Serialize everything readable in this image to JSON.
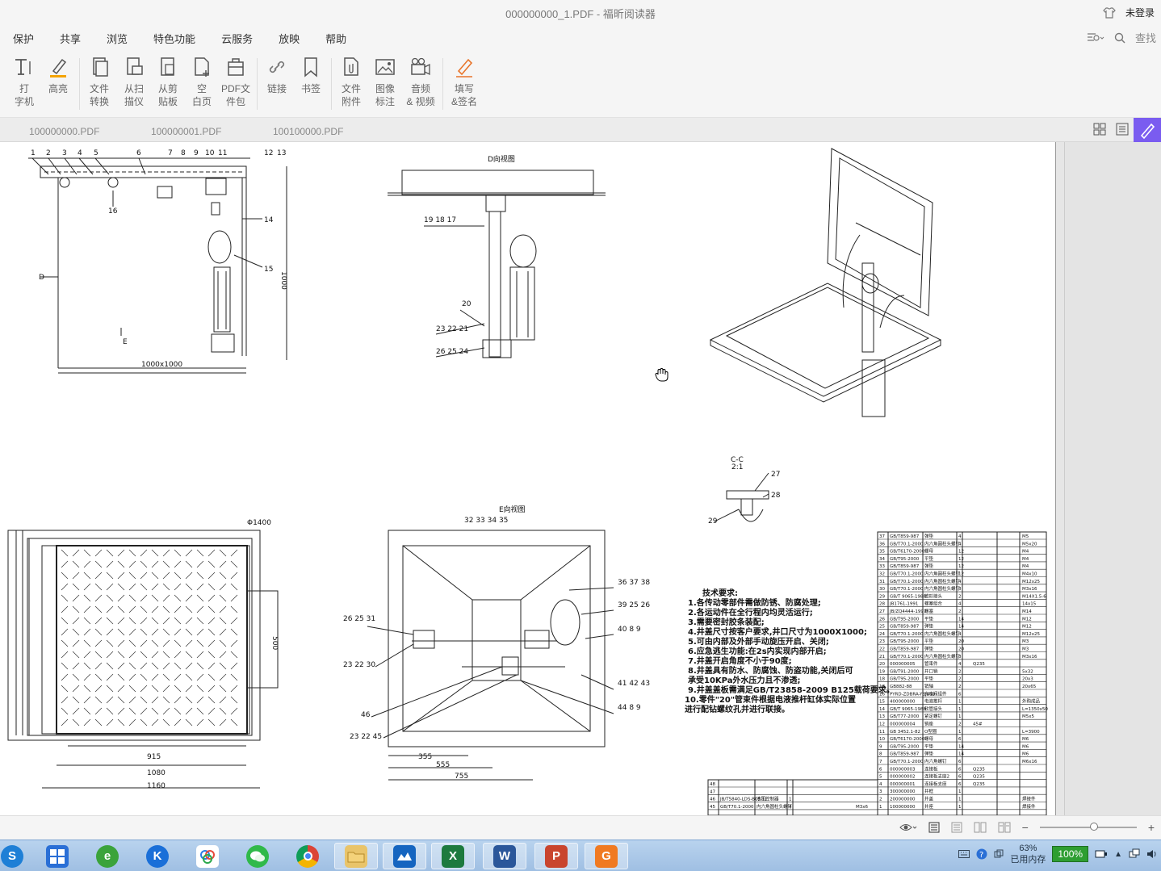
{
  "window": {
    "title": "000000000_1.PDF - 福昕阅读器",
    "login": "未登录"
  },
  "menu": [
    "保护",
    "共享",
    "浏览",
    "特色功能",
    "云服务",
    "放映",
    "帮助"
  ],
  "search": {
    "label": "查找"
  },
  "ribbon": [
    {
      "label1": "打",
      "label2": "字机",
      "icon": "typewriter-icon"
    },
    {
      "label1": "高亮",
      "label2": "",
      "icon": "highlight-icon"
    },
    {
      "label1": "文件",
      "label2": "转换",
      "icon": "file-convert-icon"
    },
    {
      "label1": "从扫",
      "label2": "描仪",
      "icon": "scanner-icon"
    },
    {
      "label1": "从剪",
      "label2": "贴板",
      "icon": "clipboard-icon"
    },
    {
      "label1": "空",
      "label2": "白页",
      "icon": "blank-page-icon"
    },
    {
      "label1": "PDF文",
      "label2": "件包",
      "icon": "pdf-package-icon"
    },
    {
      "label1": "链接",
      "label2": "",
      "icon": "link-icon"
    },
    {
      "label1": "书签",
      "label2": "",
      "icon": "bookmark-icon"
    },
    {
      "label1": "文件",
      "label2": "附件",
      "icon": "attachment-icon"
    },
    {
      "label1": "图像",
      "label2": "标注",
      "icon": "image-annotation-icon"
    },
    {
      "label1": "音频",
      "label2": "& 视频",
      "icon": "audio-video-icon"
    },
    {
      "label1": "填写",
      "label2": "&签名",
      "icon": "fill-sign-icon"
    }
  ],
  "tabs": [
    "100000000.PDF",
    "100000001.PDF",
    "100100000.PDF"
  ],
  "drawing": {
    "view_d": "D向视图",
    "view_e": "E向视图",
    "section": "C-C",
    "scale": "2:1",
    "dim_1000x1000": "1000x1000",
    "dim_1000": "1000",
    "dim_915": "915",
    "dim_1080": "1080",
    "dim_1160": "1160",
    "dim_500": "500",
    "dim_355": "355",
    "dim_555": "555",
    "dim_755": "755",
    "dim_phi": "Φ1400",
    "label_d": "D",
    "label_e": "E",
    "top_callouts": [
      "1",
      "2",
      "3",
      "4",
      "5",
      "6",
      "7",
      "8",
      "9",
      "10",
      "11",
      "12",
      "13"
    ],
    "side_callouts": [
      "14",
      "15",
      "16"
    ],
    "mid_callouts_a": "19  18  17",
    "mid_callouts_b": "20",
    "mid_callouts_c": "23  22  21",
    "mid_callouts_d": "26  25  24",
    "e_callouts": [
      "32  33  34  35",
      "36  37  38",
      "39  25  26",
      "40  8  9",
      "41  42  43",
      "44  8  9",
      "26  25  31",
      "23  22  30",
      "46",
      "23  22  45"
    ],
    "c_callouts": [
      "27",
      "28",
      "29"
    ],
    "notes_title": "技术要求:",
    "notes": [
      "1.各传动零部件需做防锈、防腐处理;",
      "2.各运动件在全行程内均灵活运行;",
      "3.需要密封胶条装配;",
      "4.井盖尺寸按客户要求,井口尺寸为1000X1000;",
      "5.可由内部及外部手动旋压开启、关闭;",
      "6.应急逃生功能:在2s内实现内部开启;",
      "7.井盖开启角度不小于90度;",
      "8.井盖具有防水、防腐蚀、防盗功能,关闭后可",
      "  承受10KPa外水压力且不渗透;",
      "9.井盖盖板需满足GB/T23858-2009 B125载荷要求。",
      "10.零件\"20\"管束件根据电液推杆缸体实际位置",
      "   进行配钻螺纹孔并进行联接。"
    ],
    "bom": [
      [
        "37",
        "GB/T859-987",
        "弹垫",
        "4",
        "",
        "M5"
      ],
      [
        "36",
        "GB/T70.1-2000",
        "内六角圆柱头螺钉",
        "4",
        "",
        "M5x20"
      ],
      [
        "35",
        "GB/T6170-2000",
        "螺母",
        "12",
        "",
        "M4"
      ],
      [
        "34",
        "GB/T95-2000",
        "平垫",
        "12",
        "",
        "M4"
      ],
      [
        "33",
        "GB/T859-987",
        "弹垫",
        "12",
        "",
        "M4"
      ],
      [
        "32",
        "GB/T70.1-2000",
        "内六角圆柱头螺钉",
        "12",
        "",
        "M4x10"
      ],
      [
        "31",
        "GB/T70.1-2000",
        "内六角圆柱头螺钉",
        "4",
        "",
        "M12x25"
      ],
      [
        "30",
        "GB/T70.1-2000",
        "内六角圆柱头螺钉",
        "8",
        "",
        "M3x16"
      ],
      [
        "29",
        "GB/T 9065-1988",
        "锥形接头",
        "2",
        "",
        "M14X1.5-6"
      ],
      [
        "28",
        "JB1761-1991",
        "螺塞组合",
        "4",
        "",
        "14x15"
      ],
      [
        "27",
        "JB/ZQ4444-1997",
        "螺塞",
        "2",
        "",
        "M14"
      ],
      [
        "26",
        "GB/T95-2000",
        "平垫",
        "14",
        "",
        "M12"
      ],
      [
        "25",
        "GB/T859-987",
        "弹垫",
        "14",
        "",
        "M12"
      ],
      [
        "24",
        "GB/T70.1-2000",
        "内六角圆柱头螺钉",
        "4",
        "",
        "M12x25"
      ],
      [
        "23",
        "GB/T95-2000",
        "平垫",
        "20",
        "",
        "M3"
      ],
      [
        "22",
        "GB/T859-987",
        "弹垫",
        "20",
        "",
        "M3"
      ],
      [
        "21",
        "GB/T70.1-2000",
        "内六角圆柱头螺钉",
        "8",
        "",
        "M3x16"
      ],
      [
        "20",
        "000000005",
        "管束件",
        "4",
        "Q235",
        ""
      ],
      [
        "19",
        "GB/T91-2000",
        "开口销",
        "2",
        "",
        "5x32"
      ],
      [
        "18",
        "GB/T95-2000",
        "平垫",
        "2",
        "",
        "20x3"
      ],
      [
        "17",
        "GB882-88",
        "销轴",
        "2",
        "",
        "20x65"
      ],
      [
        "16",
        "PYRD-ZDBRA-YBJ450",
        "充电阀组件",
        "6",
        "",
        ""
      ],
      [
        "15",
        "400000000",
        "电液推杆",
        "1",
        "",
        "外购成品"
      ],
      [
        "14",
        "GB/T 9065-1988",
        "软管接头",
        "1",
        "",
        "L=1350x50"
      ],
      [
        "13",
        "GB/T77-2000",
        "紧定螺钉",
        "1",
        "",
        "M5x5"
      ],
      [
        "12",
        "000000004",
        "销座",
        "2",
        "45#",
        ""
      ],
      [
        "11",
        "GB 3452.1-82",
        "O型圈",
        "1",
        "",
        "L=3900"
      ],
      [
        "10",
        "GB/T6170-2000",
        "螺母",
        "6",
        "",
        "M6"
      ],
      [
        "9",
        "GB/T95-2000",
        "平垫",
        "14",
        "",
        "M6"
      ],
      [
        "8",
        "GB/T859-987",
        "弹垫",
        "14",
        "",
        "M6"
      ],
      [
        "7",
        "GB/T70.1-2000",
        "内六角螺钉",
        "6",
        "",
        "M6x16"
      ],
      [
        "6",
        "000000003",
        "连接板",
        "6",
        "Q235",
        ""
      ],
      [
        "5",
        "000000002",
        "连接板支座2",
        "6",
        "Q235",
        ""
      ],
      [
        "4",
        "000000001",
        "连接板支座",
        "6",
        "Q235",
        ""
      ],
      [
        "3",
        "300000000",
        "井框",
        "1",
        "",
        ""
      ],
      [
        "2",
        "200000000",
        "井盖",
        "1",
        "",
        "焊接件"
      ],
      [
        "1",
        "100000000",
        "井座",
        "1",
        "",
        "焊接件"
      ]
    ],
    "bom2": [
      [
        "48",
        "",
        "",
        "",
        "",
        ""
      ],
      [
        "47",
        "",
        "",
        "",
        "",
        ""
      ],
      [
        "46",
        "JB/T5840-LDS-B05-T1",
        "液压控制器",
        "1",
        "",
        ""
      ],
      [
        "45",
        "GB/T70.1-2000",
        "内六角圆柱头螺钉",
        "4",
        "",
        "M3x6"
      ]
    ]
  },
  "status": {
    "zoom": "100%"
  },
  "taskbar": {
    "apps": [
      "sogou-icon",
      "metro-icon",
      "ie-icon",
      "kugou-icon",
      "baidu-cloud-icon",
      "wechat-icon",
      "chrome-icon",
      "explorer-icon",
      "feishu-icon",
      "excel-icon",
      "word-icon",
      "powerpoint-icon",
      "foxit-icon"
    ],
    "memory_pct": "63%",
    "memory_label": "已用内存",
    "battery": "100%"
  }
}
